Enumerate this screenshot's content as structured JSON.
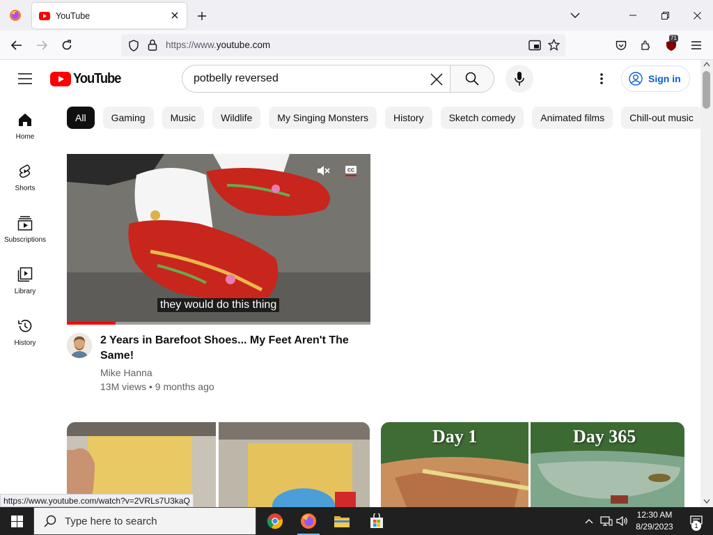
{
  "browser": {
    "tab_title": "YouTube",
    "url_prefix": "https://www.",
    "url_domain": "youtube.com",
    "extension_badge": "71",
    "status_url": "https://www.youtube.com/watch?v=2VRLs7U3kaQ"
  },
  "youtube": {
    "logo_text": "YouTube",
    "search_value": "potbelly reversed",
    "signin_label": "Sign in",
    "sidebar": [
      {
        "label": "Home",
        "icon": "home-icon"
      },
      {
        "label": "Shorts",
        "icon": "shorts-icon"
      },
      {
        "label": "Subscriptions",
        "icon": "subscriptions-icon"
      },
      {
        "label": "Library",
        "icon": "library-icon"
      },
      {
        "label": "History",
        "icon": "history-icon"
      }
    ],
    "chips": [
      "All",
      "Gaming",
      "Music",
      "Wildlife",
      "My Singing Monsters",
      "History",
      "Sketch comedy",
      "Animated films",
      "Chill-out music"
    ],
    "active_chip": "All",
    "featured_video": {
      "caption": "they would do this thing",
      "progress": 0.16,
      "title": "2 Years in Barefoot Shoes... My Feet Aren't The Same!",
      "channel": "Mike Hanna",
      "meta": "13M views • 9 months ago"
    },
    "next_videos": [
      {
        "overlay_left": "",
        "overlay_right": ""
      },
      {
        "overlay_left": "Day 1",
        "overlay_right": "Day 365"
      }
    ]
  },
  "taskbar": {
    "search_placeholder": "Type here to search",
    "time": "12:30 AM",
    "date": "8/29/2023",
    "notification_count": "1"
  },
  "colors": {
    "brand_red": "#ff0000",
    "link_blue": "#065fd4",
    "chip_bg": "#f2f2f2"
  }
}
